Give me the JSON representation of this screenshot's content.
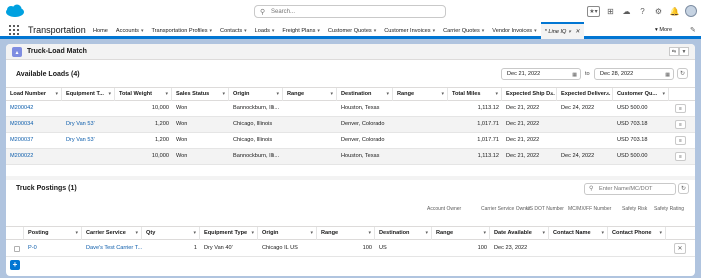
{
  "header": {
    "search_placeholder": "Search...",
    "icons": [
      "star-icon",
      "add-icon",
      "cloud-icon",
      "help-icon",
      "gear-icon",
      "bell-icon",
      "avatar"
    ]
  },
  "nav": {
    "app_name": "Transportation",
    "items": [
      {
        "label": "Home",
        "has_menu": false
      },
      {
        "label": "Accounts",
        "has_menu": true
      },
      {
        "label": "Transportation Profiles",
        "has_menu": true
      },
      {
        "label": "Contacts",
        "has_menu": true
      },
      {
        "label": "Loads",
        "has_menu": true
      },
      {
        "label": "Freight Plans",
        "has_menu": true
      },
      {
        "label": "Customer Quotes",
        "has_menu": true
      },
      {
        "label": "Customer Invoices",
        "has_menu": true
      },
      {
        "label": "Carrier Quotes",
        "has_menu": true
      },
      {
        "label": "Vendor Invoices",
        "has_menu": true
      }
    ],
    "active_tab": "* Line IQ",
    "more_label": "More",
    "accent": "#0176d3"
  },
  "card": {
    "title": "Truck-Load Match"
  },
  "loads": {
    "title": "Available Loads (4)",
    "date_from": "Dec 21, 2022",
    "to_label": "to",
    "date_to": "Dec 28, 2022",
    "columns": [
      "Load Number",
      "Equipment T...",
      "Total Weight",
      "Sales Status",
      "Origin",
      "Range",
      "Destination",
      "Range",
      "Total Miles",
      "Expected Ship D...",
      "Expected Deliver...",
      "Customer Qu..."
    ],
    "rows": [
      [
        "M200042",
        "",
        "10,000",
        "Won",
        "Bannockburn, Illi...",
        "",
        "Houston, Texas",
        "",
        "1,113.12",
        "Dec 21, 2022",
        "Dec 24, 2022",
        "USD 500.00"
      ],
      [
        "M200034",
        "Dry Van 53'",
        "1,200",
        "Won",
        "Chicago, Illinois",
        "",
        "Denver, Colorado",
        "",
        "1,017.71",
        "Dec 21, 2022",
        "",
        "USD 703.18"
      ],
      [
        "M200037",
        "Dry Van 53'",
        "1,200",
        "Won",
        "Chicago, Illinois",
        "",
        "Denver, Colorado",
        "",
        "1,017.71",
        "Dec 21, 2022",
        "",
        "USD 703.18"
      ],
      [
        "M200022",
        "",
        "10,000",
        "Won",
        "Bannockburn, Illi...",
        "",
        "Houston, Texas",
        "",
        "1,113.12",
        "Dec 21, 2022",
        "Dec 24, 2022",
        "USD 500.00"
      ]
    ]
  },
  "postings": {
    "title": "Truck Postings (1)",
    "search_placeholder": "Enter Name/MC/DOT",
    "extra_columns": [
      "Account Owner",
      "Carrier Service Owner",
      "US DOT Number",
      "MC/MX/FF Number",
      "Safety Risk",
      "Safety Rating"
    ],
    "columns": [
      "Posting",
      "Carrier Service",
      "Qty",
      "Equipment Type",
      "Origin",
      "Range",
      "Destination",
      "Range",
      "Date Available",
      "Contact Name",
      "Contact Phone"
    ],
    "rows": [
      [
        "P-0",
        "Dave's Test Carrier T...",
        "1",
        "Dry Van 40'",
        "Chicago IL US",
        "100",
        "US",
        "100",
        "Dec 23, 2022",
        "",
        ""
      ]
    ]
  }
}
